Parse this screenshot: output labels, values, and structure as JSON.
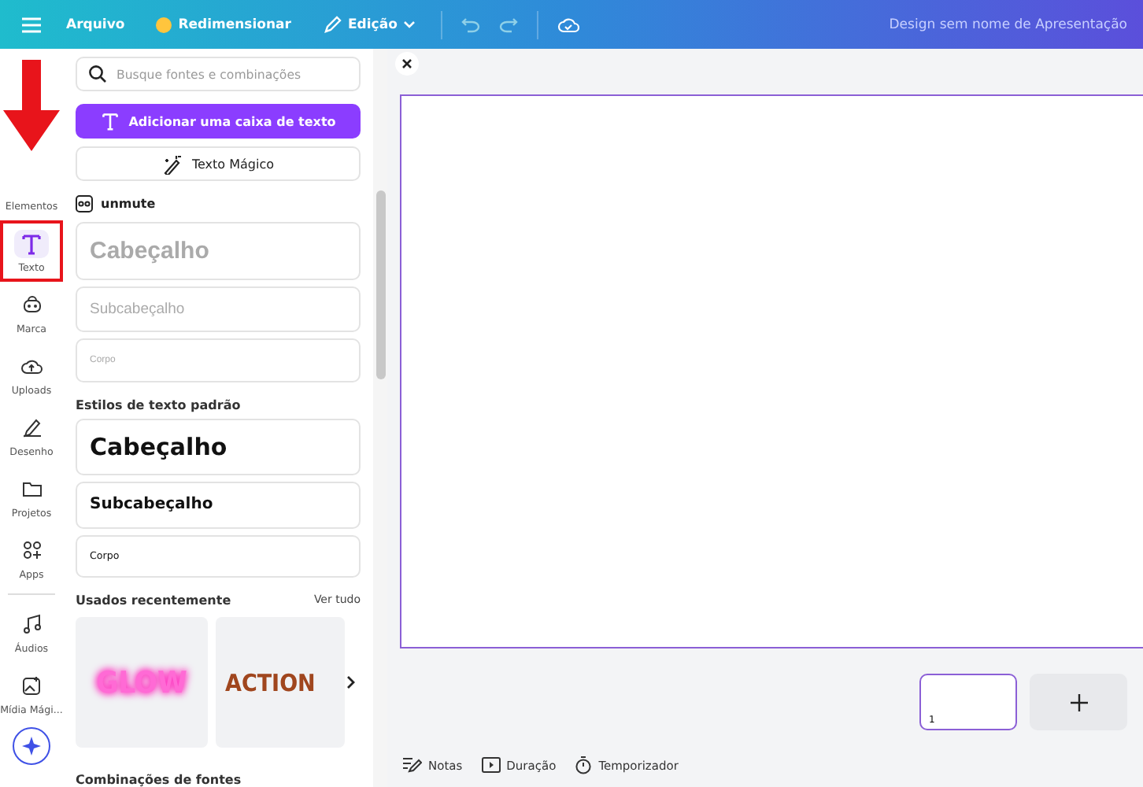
{
  "topbar": {
    "items": [
      {
        "label": "Arquivo",
        "kind": "plain"
      },
      {
        "label": "Redimensionar",
        "kind": "crown"
      },
      {
        "label": "Edição",
        "kind": "dropdown"
      }
    ],
    "title": "Design sem nome de Apresentação"
  },
  "rail": {
    "items": [
      {
        "label": "Elementos",
        "selected": false,
        "highlighted": false
      },
      {
        "label": "Texto",
        "selected": true,
        "highlighted": true
      },
      {
        "label": "Marca",
        "selected": false,
        "highlighted": false
      },
      {
        "label": "Uploads",
        "selected": false,
        "highlighted": false
      },
      {
        "label": "Desenho",
        "selected": false,
        "highlighted": false
      },
      {
        "label": "Projetos",
        "selected": false,
        "highlighted": false
      },
      {
        "label": "Apps",
        "selected": false,
        "highlighted": false
      },
      {
        "label": "Áudios",
        "selected": false,
        "highlighted": false
      },
      {
        "label": "Mídia Mági...",
        "selected": false,
        "highlighted": false
      }
    ],
    "arrow": true
  },
  "panel": {
    "search": {
      "placeholder": "Busque fontes e combinações"
    },
    "add_button": "Adicionar uma caixa de texto",
    "magic_button": "Texto Mágico",
    "brand_kit": {
      "name": "unmute",
      "styles": [
        {
          "kind": "heading",
          "text": "Cabeçalho"
        },
        {
          "kind": "subheading",
          "text": "Subcabeçalho"
        },
        {
          "kind": "body",
          "text": "Corpo"
        }
      ]
    },
    "default_styles": {
      "title": "Estilos de texto padrão",
      "styles": [
        {
          "kind": "heading",
          "text": "Cabeçalho"
        },
        {
          "kind": "subheading",
          "text": "Subcabeçalho"
        },
        {
          "kind": "body",
          "text": "Corpo"
        }
      ]
    },
    "recent": {
      "title": "Usados recentemente",
      "see_all": "Ver tudo",
      "items": [
        {
          "kind": "glow",
          "text": "GLOW"
        },
        {
          "kind": "outline",
          "text": "ACTION"
        }
      ]
    },
    "combos_title": "Combinações de fontes"
  },
  "pages": [
    {
      "number": "1",
      "selected": true
    }
  ],
  "bottom_bar": [
    {
      "label": "Notas"
    },
    {
      "label": "Duração"
    },
    {
      "label": "Temporizador"
    }
  ]
}
